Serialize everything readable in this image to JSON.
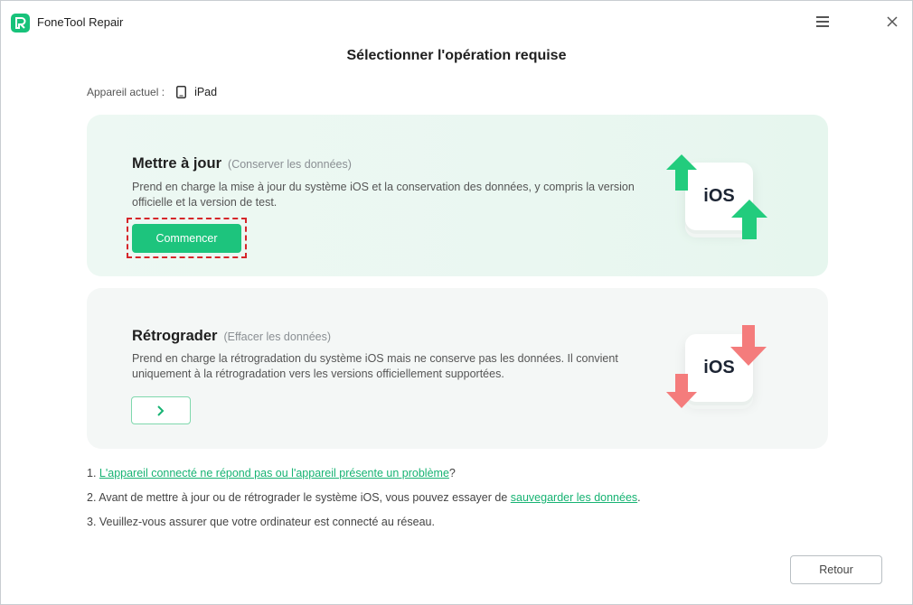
{
  "app": {
    "title": "FoneTool Repair"
  },
  "page": {
    "title": "Sélectionner l'opération requise",
    "device_label": "Appareil actuel :",
    "device_name": "iPad"
  },
  "update_card": {
    "title": "Mettre à jour",
    "subtitle": "(Conserver les données)",
    "description": "Prend en charge la mise à jour du système iOS et la conservation des données, y compris la version officielle et la version de test.",
    "button_label": "Commencer",
    "illustration_text": "iOS"
  },
  "downgrade_card": {
    "title": "Rétrograder",
    "subtitle": "(Effacer les données)",
    "description": "Prend en charge la rétrogradation du système iOS mais ne conserve pas les données. Il convient uniquement à la rétrogradation vers les versions officiellement supportées.",
    "illustration_text": "iOS"
  },
  "notes": {
    "n1_prefix": "1. ",
    "n1_link": "L'appareil connecté ne répond pas ou l'appareil présente un problème",
    "n1_suffix": "?",
    "n2_prefix": "2. Avant de mettre à jour ou de rétrograder le système iOS, vous pouvez essayer de ",
    "n2_link": "sauvegarder les données",
    "n2_suffix": ".",
    "n3": "3. Veuillez-vous assurer que votre ordinateur est connecté au réseau."
  },
  "footer": {
    "back_label": "Retour"
  },
  "colors": {
    "accent": "#1dc47d",
    "highlight": "#d6262a",
    "downgrade_arrow": "#f47c7c"
  },
  "icons": {
    "menu": "hamburger-menu-icon",
    "close": "close-icon",
    "device": "ipad-icon",
    "arrow_button": "chevron-right-icon"
  }
}
